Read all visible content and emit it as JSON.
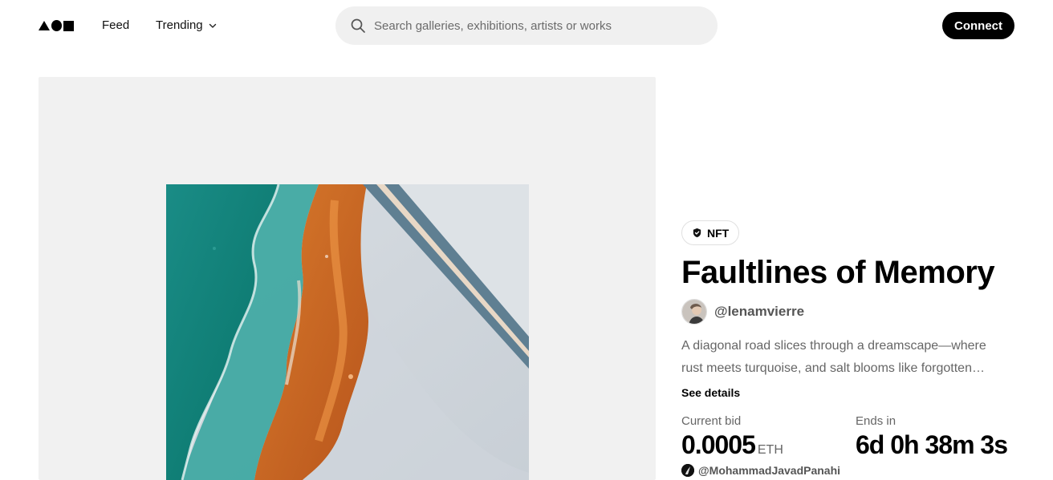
{
  "header": {
    "nav": {
      "feed": "Feed",
      "trending": "Trending"
    },
    "search": {
      "placeholder": "Search galleries, exhibitions, artists or works"
    },
    "connect_label": "Connect"
  },
  "artwork": {
    "badge": "NFT",
    "title": "Faultlines of Memory",
    "artist_handle": "@lenamvierre",
    "description_line1": "A diagonal road slices through a dreamscape—where",
    "description_line2": "rust meets turquoise, and salt blooms like forgotten…",
    "see_details": "See details"
  },
  "auction": {
    "current_bid_label": "Current bid",
    "current_bid_value": "0.0005",
    "current_bid_unit": "ETH",
    "ends_in_label": "Ends in",
    "ends_in_value": "6d 0h 38m 3s",
    "top_bidder": "@MohammadJavadPanahi"
  },
  "colors": {
    "primary": "#000000",
    "search_bg": "#f0f0f0",
    "panel_bg": "#f1f1f1",
    "muted_text": "#666666"
  },
  "icons": {
    "search": "search-icon",
    "trending_chevron": "chevron-down-icon",
    "badge": "verified-shield-icon"
  }
}
